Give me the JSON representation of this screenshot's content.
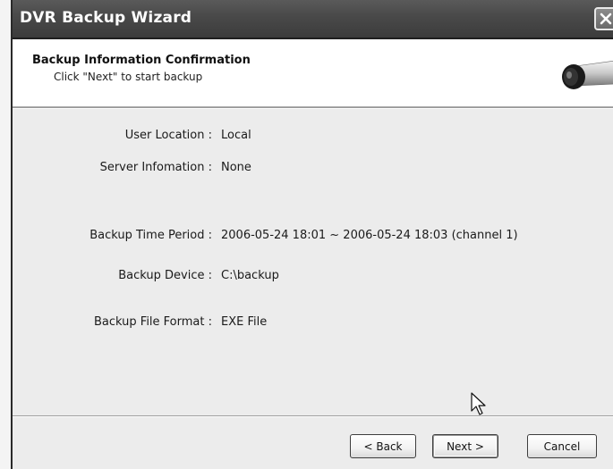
{
  "window": {
    "title": "DVR Backup Wizard",
    "close_icon": "close-icon"
  },
  "header": {
    "title": "Backup Information Confirmation",
    "subtitle": "Click \"Next\" to start backup",
    "icon": "camera-icon"
  },
  "info": {
    "user_location": {
      "label": "User Location :",
      "value": "Local"
    },
    "server_information": {
      "label": "Server Infomation :",
      "value": "None"
    },
    "backup_time_period": {
      "label": "Backup Time Period :",
      "value": "2006-05-24 18:01 ~ 2006-05-24 18:03 (channel 1)"
    },
    "backup_device": {
      "label": "Backup Device :",
      "value": "C:\\backup"
    },
    "backup_file_format": {
      "label": "Backup File Format :",
      "value": "EXE File"
    }
  },
  "footer": {
    "back_label": "< Back",
    "next_label": "Next >",
    "cancel_label": "Cancel"
  },
  "cursor": {
    "icon": "mouse-pointer-icon"
  }
}
